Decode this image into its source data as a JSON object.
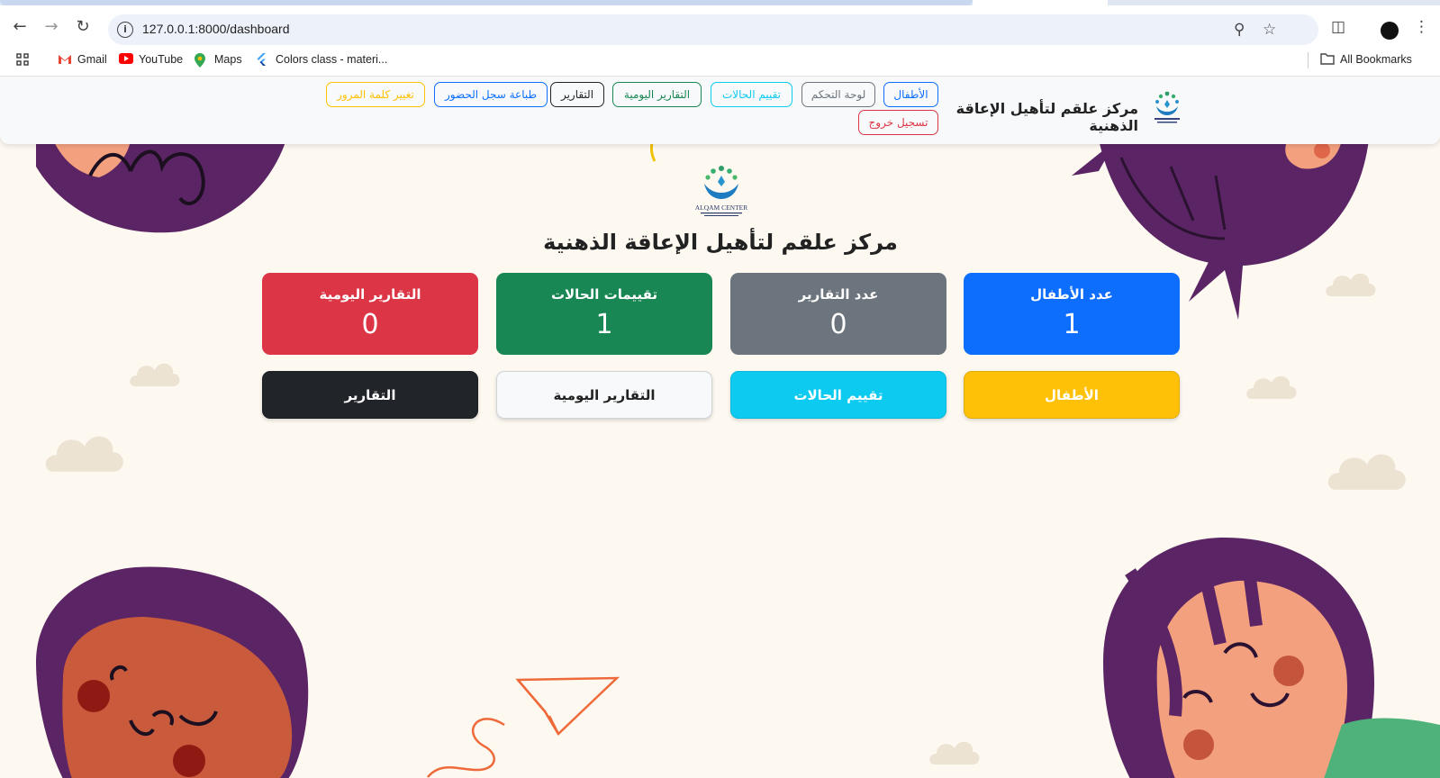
{
  "browser": {
    "url": "127.0.0.1:8000/dashboard",
    "bookmarks": [
      {
        "label": "Gmail",
        "icon": "gmail-icon"
      },
      {
        "label": "YouTube",
        "icon": "youtube-icon"
      },
      {
        "label": "Maps",
        "icon": "maps-icon"
      },
      {
        "label": "Colors class - materi...",
        "icon": "flutter-icon"
      }
    ],
    "all_bookmarks": "All Bookmarks"
  },
  "navbar": {
    "brand": "مركز علقم لتأهيل الإعاقة الذهنية",
    "links": {
      "children": "الأطفال",
      "dashboard": "لوحة التحكم",
      "evaluation": "تقييم الحالات",
      "daily_reports": "التقارير اليومية",
      "reports": "التقارير",
      "print_attendance": "طباعة سجل الحضور",
      "change_password": "تغيير كلمة المرور",
      "logout": "تسجيل خروج"
    }
  },
  "main": {
    "title": "مركز علقم لتأهيل الإعاقة الذهنية",
    "logo_text": "ALQAM CENTER",
    "stats": [
      {
        "label": "عدد الأطفال",
        "value": "1",
        "color": "#0d6efd"
      },
      {
        "label": "عدد التقارير",
        "value": "0",
        "color": "#6c757d"
      },
      {
        "label": "تقييمات الحالات",
        "value": "1",
        "color": "#198754"
      },
      {
        "label": "التقارير اليومية",
        "value": "0",
        "color": "#dc3545"
      }
    ],
    "actions": [
      {
        "label": "الأطفال",
        "color": "#ffc107"
      },
      {
        "label": "تقييم الحالات",
        "color": "#0dcaf0"
      },
      {
        "label": "التقارير اليومية",
        "color": "#f8f9fa"
      },
      {
        "label": "التقارير",
        "color": "#212529"
      }
    ]
  }
}
